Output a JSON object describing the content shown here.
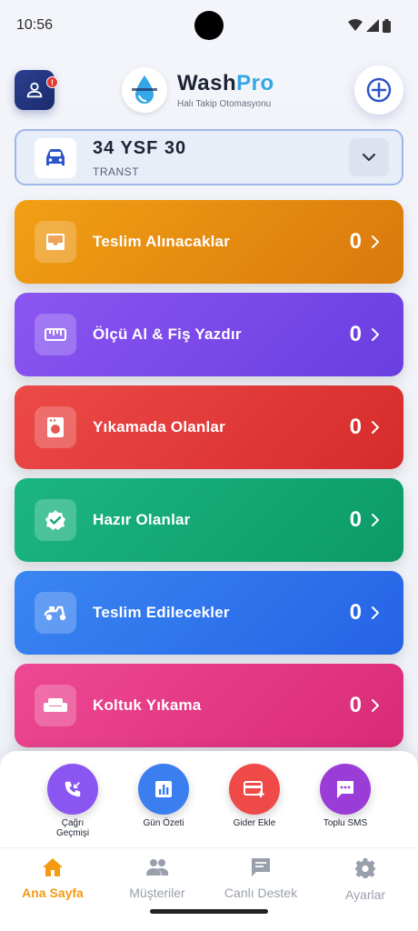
{
  "status": {
    "time": "10:56"
  },
  "header": {
    "brand_prefix": "Wash",
    "brand_suffix": "Pro",
    "subtitle": "Halı Takip Otomasyonu",
    "notification_badge": "!"
  },
  "vehicle": {
    "plate": "34 YSF 30",
    "type": "TRANST"
  },
  "cards": [
    {
      "label": "Teslim Alınacaklar",
      "count": "0",
      "color_from": "#f2a015",
      "color_to": "#d9780c",
      "icon": "inbox-icon"
    },
    {
      "label": "Ölçü Al & Fiş Yazdır",
      "count": "0",
      "color_from": "#8b55f2",
      "color_to": "#6a3ee0",
      "icon": "ruler-icon"
    },
    {
      "label": "Yıkamada Olanlar",
      "count": "0",
      "color_from": "#ec4a48",
      "color_to": "#d62b2b",
      "icon": "washing-machine-icon"
    },
    {
      "label": "Hazır Olanlar",
      "count": "0",
      "color_from": "#1cb682",
      "color_to": "#0b9a67",
      "icon": "verified-badge-icon"
    },
    {
      "label": "Teslim Edilecekler",
      "count": "0",
      "color_from": "#3a86f2",
      "color_to": "#2563e6",
      "icon": "scooter-icon"
    },
    {
      "label": "Koltuk Yıkama",
      "count": "0",
      "color_from": "#ee4994",
      "color_to": "#d92a77",
      "icon": "sofa-icon"
    }
  ],
  "quick_actions": [
    {
      "label": "Çağrı Geçmişi",
      "color": "#8b55f2",
      "icon": "call-history-icon"
    },
    {
      "label": "Gün Özeti",
      "color": "#3a7ef0",
      "icon": "bar-chart-icon"
    },
    {
      "label": "Gider Ekle",
      "color": "#ef4a48",
      "icon": "add-card-icon"
    },
    {
      "label": "Toplu SMS",
      "color": "#9a3cd8",
      "icon": "sms-icon"
    }
  ],
  "nav": [
    {
      "label": "Ana Sayfa",
      "active": true,
      "icon": "home-icon"
    },
    {
      "label": "Müşteriler",
      "active": false,
      "icon": "people-icon"
    },
    {
      "label": "Canlı Destek",
      "active": false,
      "icon": "chat-icon"
    },
    {
      "label": "Ayarlar",
      "active": false,
      "icon": "settings-icon"
    }
  ],
  "colors": {
    "accent": "#f59a11",
    "brand_blue": "#35a7e6",
    "nav_inactive": "#9aa0ab"
  }
}
